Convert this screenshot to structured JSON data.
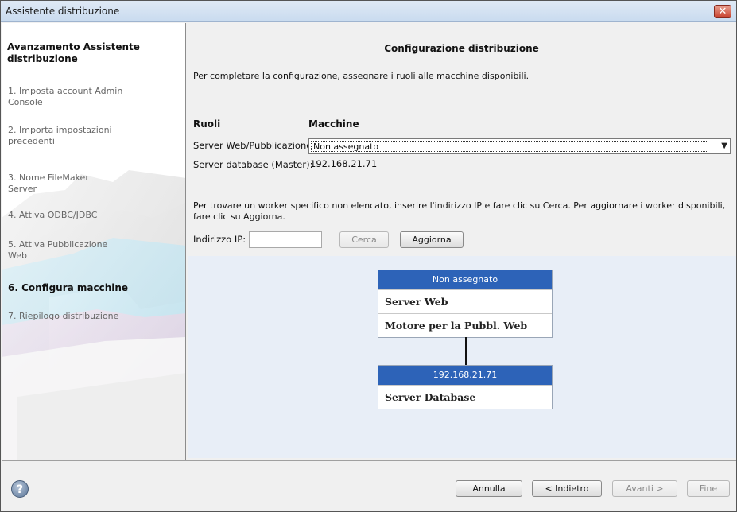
{
  "window": {
    "title": "Assistente distribuzione",
    "close_glyph": "✕"
  },
  "sidebar": {
    "heading": "Avanzamento Assistente distribuzione",
    "steps": [
      {
        "label": "1. Imposta account Admin Console"
      },
      {
        "label": "2. Importa impostazioni precedenti"
      },
      {
        "label": "3. Nome FileMaker Server"
      },
      {
        "label": "4. Attiva ODBC/JDBC"
      },
      {
        "label": "5. Attiva Pubblicazione Web"
      },
      {
        "label": "6. Configura macchine",
        "active": true
      },
      {
        "label": "7. Riepilogo distribuzione"
      }
    ]
  },
  "main": {
    "title": "Configurazione distribuzione",
    "intro": "Per completare la configurazione, assegnare i ruoli alle macchine disponibili.",
    "roles_header": "Ruoli",
    "machines_header": "Macchine",
    "roles": [
      {
        "label": "Server Web/Pubblicazione:",
        "value": "Non assegnato"
      },
      {
        "label": "Server database (Master):",
        "value": "192.168.21.71"
      }
    ],
    "help_text": "Per trovare un worker specifico non elencato, inserire l'indirizzo IP e fare clic su Cerca.  Per aggiornare i worker disponibili, fare clic su Aggiorna.",
    "ip_label": "Indirizzo IP:",
    "ip_value": "",
    "search_button": "Cerca",
    "refresh_button": "Aggiorna",
    "diagram": {
      "web_node": {
        "header": "Non assegnato",
        "rows": [
          "Server Web",
          "Motore per la Pubbl. Web"
        ]
      },
      "db_node": {
        "header": "192.168.21.71",
        "rows": [
          "Server Database"
        ]
      }
    }
  },
  "footer": {
    "help_icon": "?",
    "cancel": "Annulla",
    "back": "< Indietro",
    "next": "Avanti >",
    "finish": "Fine"
  },
  "colors": {
    "node_header": "#2d63b8",
    "canvas": "#e8eef7"
  }
}
